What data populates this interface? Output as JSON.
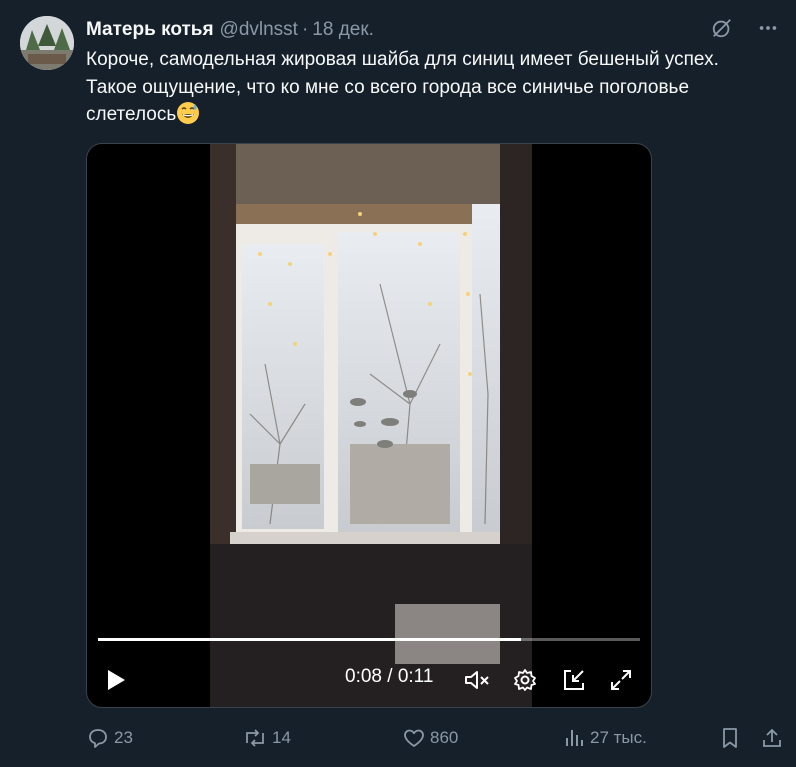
{
  "tweet": {
    "author_name": "Матерь котья",
    "handle": "@dvlnsst",
    "separator": "·",
    "date": "18 дек.",
    "text": "Короче, самодельная жировая шайба для синиц имеет бешеный успех.\nТакое ощущение, что ко мне со всего города все синичье поголовье\nслетелось"
  },
  "video": {
    "time_current": "0:08",
    "time_separator": " / ",
    "time_total": "0:11",
    "progress_fraction": 0.78
  },
  "actions": {
    "replies": "23",
    "reposts": "14",
    "likes": "860",
    "views": "27 тыс."
  },
  "icons": [
    "grok-icon",
    "more-icon",
    "play-icon",
    "mute-icon",
    "settings-icon",
    "dock-icon",
    "fullscreen-icon",
    "reply-icon",
    "repost-icon",
    "like-icon",
    "views-icon",
    "bookmark-icon",
    "share-icon"
  ],
  "colors": {
    "background": "#15202b",
    "secondary_text": "#8b98a5",
    "primary_text": "#f7f9f9"
  }
}
